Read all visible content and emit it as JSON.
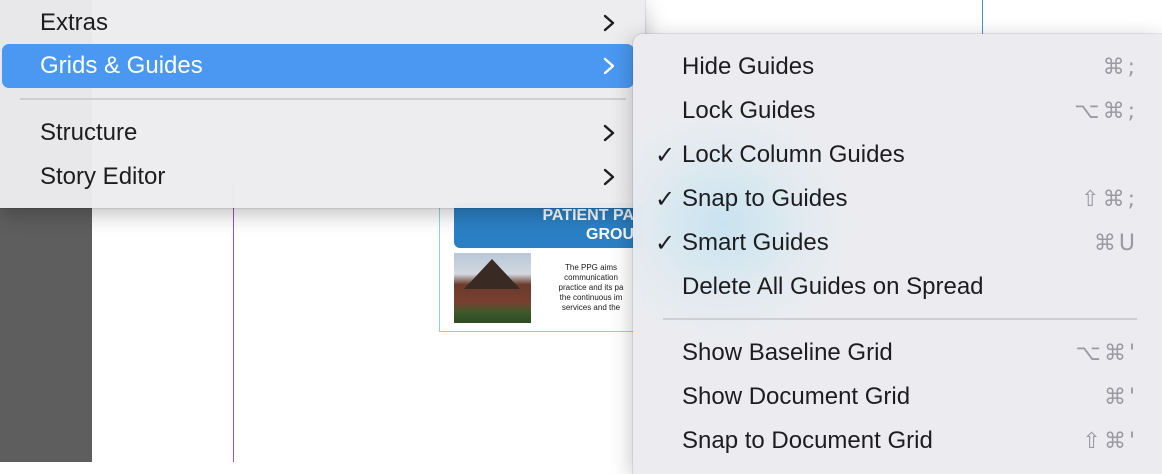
{
  "document": {
    "banner_text": "PATIENT PA\nGROU",
    "body_text": "The PPG aims\ncommunication\npractice and its pa\nthe continuous im\nservices and the"
  },
  "main_menu": {
    "items": [
      {
        "label": "Extras",
        "has_submenu": true,
        "selected": false
      },
      {
        "label": "Grids & Guides",
        "has_submenu": true,
        "selected": true
      },
      {
        "label": "Structure",
        "has_submenu": true,
        "selected": false
      },
      {
        "label": "Story Editor",
        "has_submenu": true,
        "selected": false
      }
    ],
    "chevron_icon": "chevron-right-icon",
    "selection_color": "#4a98f2"
  },
  "submenu": {
    "items": [
      {
        "label": "Hide Guides",
        "checked": false,
        "shortcut": "⌘;"
      },
      {
        "label": "Lock Guides",
        "checked": false,
        "shortcut": "⌥⌘;"
      },
      {
        "label": "Lock Column Guides",
        "checked": true,
        "shortcut": ""
      },
      {
        "label": "Snap to Guides",
        "checked": true,
        "shortcut": "⇧⌘;"
      },
      {
        "label": "Smart Guides",
        "checked": true,
        "shortcut": "⌘U"
      },
      {
        "label": "Delete All Guides on Spread",
        "checked": false,
        "shortcut": ""
      },
      {
        "label": "Show Baseline Grid",
        "checked": false,
        "shortcut": "⌥⌘'"
      },
      {
        "label": "Show Document Grid",
        "checked": false,
        "shortcut": "⌘'"
      },
      {
        "label": "Snap to Document Grid",
        "checked": false,
        "shortcut": "⇧⌘'"
      }
    ],
    "check_glyph": "✓"
  }
}
